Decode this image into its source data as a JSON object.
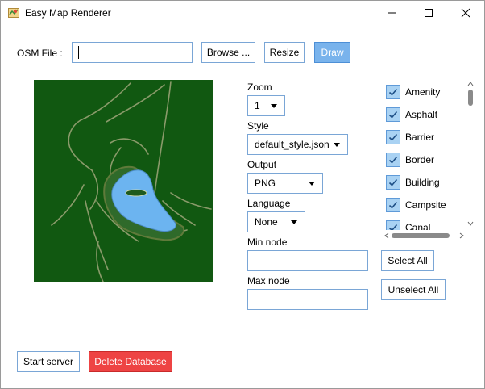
{
  "window": {
    "title": "Easy Map Renderer"
  },
  "osm": {
    "label": "OSM File :",
    "value": ""
  },
  "buttons": {
    "browse": "Browse ...",
    "resize": "Resize",
    "draw": "Draw",
    "select_all": "Select All",
    "unselect_all": "Unselect All",
    "start_server": "Start server",
    "delete_database": "Delete Database"
  },
  "options": {
    "zoom": {
      "label": "Zoom",
      "value": "1"
    },
    "style": {
      "label": "Style",
      "value": "default_style.json"
    },
    "output": {
      "label": "Output",
      "value": "PNG"
    },
    "language": {
      "label": "Language",
      "value": "None"
    },
    "min_node": {
      "label": "Min node",
      "value": ""
    },
    "max_node": {
      "label": "Max node",
      "value": ""
    }
  },
  "layers": [
    {
      "label": "Amenity",
      "checked": true
    },
    {
      "label": "Asphalt",
      "checked": true
    },
    {
      "label": "Barrier",
      "checked": true
    },
    {
      "label": "Border",
      "checked": true
    },
    {
      "label": "Building",
      "checked": true
    },
    {
      "label": "Campsite",
      "checked": true
    },
    {
      "label": "Canal",
      "checked": true
    }
  ],
  "colors": {
    "map_background": "#115811",
    "water": "#6cb4f0",
    "road": "#8a9a6a",
    "accent": "#79b3ec",
    "danger": "#ee4444",
    "control_border": "#7aa6d6"
  },
  "icons": [
    "map-app-icon",
    "minimize-icon",
    "maximize-icon",
    "close-icon",
    "chevron-down-icon",
    "checkmark-icon"
  ]
}
